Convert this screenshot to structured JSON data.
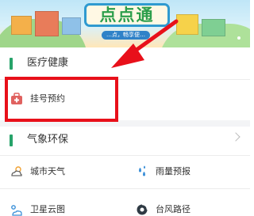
{
  "banner": {
    "sign_text": "点点通",
    "ribbon_text": "…点，畅享便…"
  },
  "sections": [
    {
      "title": "医疗健康"
    },
    {
      "title": "气象环保"
    }
  ],
  "medical": {
    "tiles": [
      {
        "label": "挂号预约",
        "icon": "hospital-bag-icon"
      }
    ]
  },
  "weather": {
    "tiles": [
      {
        "label": "城市天气",
        "icon": "cloud-sun-icon"
      },
      {
        "label": "雨量预报",
        "icon": "rain-drops-icon"
      },
      {
        "label": "卫星云图",
        "icon": "satellite-cloud-icon"
      },
      {
        "label": "台风路径",
        "icon": "typhoon-icon"
      }
    ]
  },
  "colors": {
    "accent_green": "#27a36a",
    "annotation_red": "#e8101a",
    "medical_icon": "#e0615f"
  }
}
